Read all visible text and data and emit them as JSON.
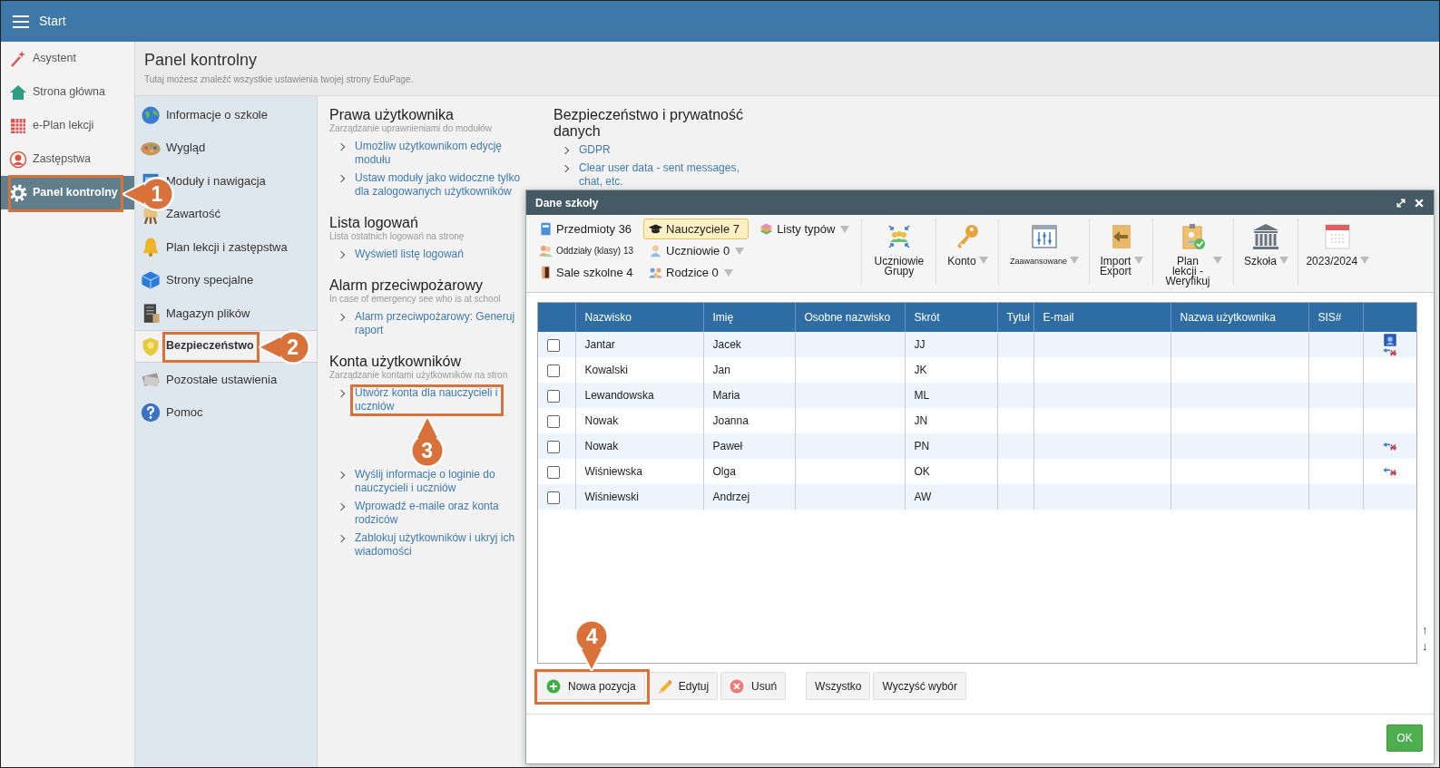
{
  "topbar": {
    "title": "Start"
  },
  "sidebar": {
    "items": [
      {
        "label": "Asystent",
        "selected": false
      },
      {
        "label": "Strona główna",
        "selected": false
      },
      {
        "label": "e-Plan lekcji",
        "selected": false
      },
      {
        "label": "Zastępstwa",
        "selected": false
      },
      {
        "label": "Panel kontrolny",
        "selected": true
      }
    ]
  },
  "header": {
    "title": "Panel kontrolny",
    "subtitle": "Tutaj możesz znaleźć wszystkie ustawienia twojej strony EduPage."
  },
  "settings_menu": {
    "items": [
      {
        "label": "Informacje o szkole",
        "selected": false
      },
      {
        "label": "Wygląd",
        "selected": false
      },
      {
        "label": "Moduły i nawigacja",
        "selected": false
      },
      {
        "label": "Zawartość",
        "selected": false
      },
      {
        "label": "Plan lekcji i zastępstwa",
        "selected": false
      },
      {
        "label": "Strony specjalne",
        "selected": false
      },
      {
        "label": "Magazyn plików",
        "selected": false
      },
      {
        "label": "Bezpieczeństwo",
        "selected": true
      },
      {
        "label": "Pozostałe ustawienia",
        "selected": false
      },
      {
        "label": "Pomoc",
        "selected": false
      }
    ]
  },
  "columns": [
    {
      "sections": [
        {
          "title": "Prawa użytkownika",
          "description": "Zarządzanie uprawnieniami do modułów",
          "links": [
            "Umożliw użytkownikom edycję modułu",
            "Ustaw moduły jako widoczne tylko dla zalogowanych użytkowników"
          ]
        },
        {
          "title": "Lista logowań",
          "description": "Lista ostatnich logowań na stronę",
          "links": [
            "Wyświetl listę logowań"
          ]
        },
        {
          "title": "Alarm przeciwpożarowy",
          "description": "In case of emergency see who is at school",
          "links": [
            "Alarm przeciwpożarowy: Generuj raport"
          ]
        },
        {
          "title": "Konta użytkowników",
          "description": "Zarządzanie kontami użytkowników na stron",
          "links": [
            "Utwórz konta dla nauczycieli i uczniów",
            "Wyślij informacje o loginie do nauczycieli i uczniów",
            "Wprowadź e-maile oraz konta rodziców",
            "Zablokuj użytkowników i ukryj ich wiadomości"
          ]
        }
      ]
    },
    {
      "sections": [
        {
          "title": "Bezpieczeństwo i prywatność danych",
          "links": [
            "GDPR",
            "Clear user data - sent messages, chat, etc."
          ]
        }
      ]
    }
  ],
  "dialog": {
    "title": "Dane szkoły",
    "filter_columns": [
      [
        {
          "label": "Przedmioty 36",
          "selected": false,
          "dropdown": false,
          "small_text": false
        },
        {
          "label": "Oddziały (klasy) 13",
          "selected": false,
          "dropdown": false,
          "small_text": true
        },
        {
          "label": "Sale szkolne 4",
          "selected": false,
          "dropdown": false,
          "small_text": false
        }
      ],
      [
        {
          "label": "Nauczyciele 7",
          "selected": true,
          "dropdown": false,
          "small_text": false
        },
        {
          "label": "Uczniowie 0",
          "selected": false,
          "dropdown": true,
          "small_text": false
        },
        {
          "label": "Rodzice 0",
          "selected": false,
          "dropdown": true,
          "small_text": false
        }
      ],
      [
        {
          "label": "Listy typów",
          "selected": false,
          "dropdown": true,
          "small_text": false
        }
      ]
    ],
    "tools": [
      {
        "label_lines": [
          "Uczniowie",
          "Grupy"
        ],
        "dropdown": false,
        "small_text": false
      },
      {
        "label_lines": [
          "Konto"
        ],
        "dropdown": true,
        "small_text": false
      },
      {
        "label_lines": [
          "Zaawansowane"
        ],
        "dropdown": true,
        "small_text": true
      },
      {
        "label_lines": [
          "Import",
          "Export"
        ],
        "dropdown": true,
        "small_text": false
      },
      {
        "label_lines": [
          "Plan",
          "lekcji -",
          "Weryfikuj"
        ],
        "dropdown": true,
        "small_text": false
      },
      {
        "label_lines": [
          "Szkoła"
        ],
        "dropdown": true,
        "small_text": false
      },
      {
        "label_lines": [
          "2023/2024"
        ],
        "dropdown": true,
        "small_text": false
      }
    ],
    "table": {
      "columns": [
        "Nazwisko",
        "Imię",
        "Osobne nazwisko",
        "Skrót",
        "Tytuł",
        "E-mail",
        "Nazwa użytkownika",
        "SIS#"
      ],
      "rows": [
        {
          "checked": false,
          "last_name": "Jantar",
          "first_name": "Jacek",
          "abbreviation": "JJ",
          "photo": true,
          "unlinked": true
        },
        {
          "checked": false,
          "last_name": "Kowalski",
          "first_name": "Jan",
          "abbreviation": "JK",
          "photo": false,
          "unlinked": false
        },
        {
          "checked": false,
          "last_name": "Lewandowska",
          "first_name": "Maria",
          "abbreviation": "ML",
          "photo": false,
          "unlinked": false
        },
        {
          "checked": false,
          "last_name": "Nowak",
          "first_name": "Joanna",
          "abbreviation": "JN",
          "photo": false,
          "unlinked": false
        },
        {
          "checked": false,
          "last_name": "Nowak",
          "first_name": "Paweł",
          "abbreviation": "PN",
          "photo": false,
          "unlinked": true
        },
        {
          "checked": false,
          "last_name": "Wiśniewska",
          "first_name": "Olga",
          "abbreviation": "OK",
          "photo": false,
          "unlinked": true
        },
        {
          "checked": false,
          "last_name": "Wiśniewski",
          "first_name": "Andrzej",
          "abbreviation": "AW",
          "photo": false,
          "unlinked": false
        }
      ]
    },
    "scroll_arrows": [
      "↑",
      "↓"
    ],
    "actions": [
      {
        "label": "Nowa pozycja",
        "kind": "add"
      },
      {
        "label": "Edytuj",
        "kind": "edit"
      },
      {
        "label": "Usuń",
        "kind": "delete"
      }
    ],
    "selection_buttons": [
      "Wszystko",
      "Wyczyść wybór"
    ],
    "ok_button": "OK"
  },
  "annotations": [
    {
      "number": "1"
    },
    {
      "number": "2"
    },
    {
      "number": "3"
    },
    {
      "number": "4"
    }
  ]
}
